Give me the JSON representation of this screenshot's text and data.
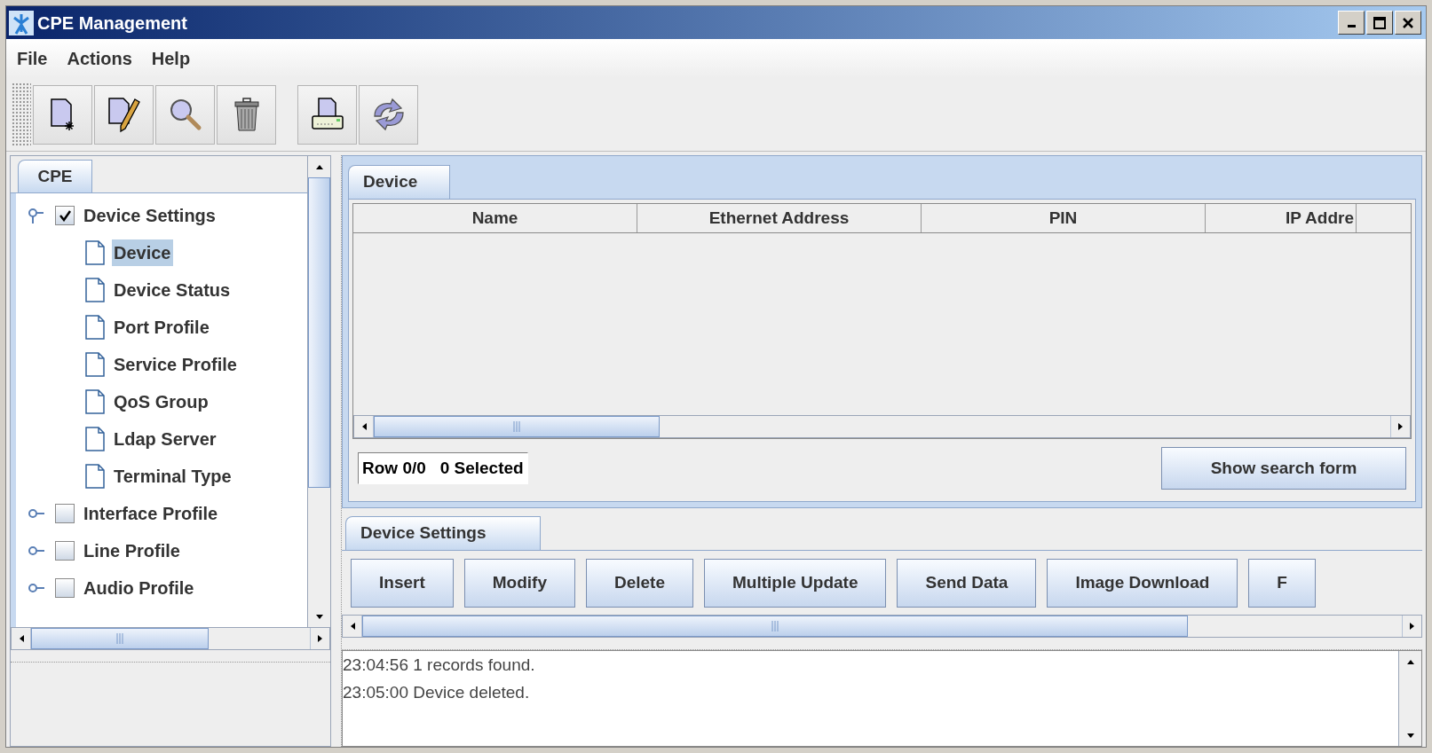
{
  "window": {
    "title": "CPE Management"
  },
  "menu": [
    "File",
    "Actions",
    "Help"
  ],
  "tree": {
    "tab": {
      "label": "CPE",
      "selected": true
    },
    "items": [
      {
        "label": "Device Settings",
        "checked": true,
        "expanded": true,
        "children": [
          {
            "label": "Device",
            "selected": true
          },
          {
            "label": "Device Status",
            "selected": false
          },
          {
            "label": "Port Profile",
            "selected": false
          },
          {
            "label": "Service Profile",
            "selected": false
          },
          {
            "label": "QoS Group",
            "selected": false
          },
          {
            "label": "Ldap Server",
            "selected": false
          },
          {
            "label": "Terminal Type",
            "selected": false
          }
        ]
      },
      {
        "label": "Interface Profile",
        "checked": false,
        "expanded": false
      },
      {
        "label": "Line Profile",
        "checked": false,
        "expanded": false
      },
      {
        "label": "Audio Profile",
        "checked": false,
        "expanded": false
      }
    ]
  },
  "device_panel": {
    "tab": {
      "label": "Device",
      "selected": true
    },
    "table": {
      "columns": [
        "Name",
        "Ethernet Address",
        "PIN",
        "IP Addre"
      ]
    },
    "status": "Row 0/0   0 Selected",
    "search_button": "Show search form"
  },
  "actions_panel": {
    "tab": {
      "label": "Device Settings",
      "selected": true
    },
    "buttons": [
      "Insert",
      "Modify",
      "Delete",
      "Multiple Update",
      "Send Data",
      "Image Download",
      "F"
    ]
  },
  "log": [
    "23:04:56 1 records found.",
    "23:05:00 Device deleted."
  ]
}
